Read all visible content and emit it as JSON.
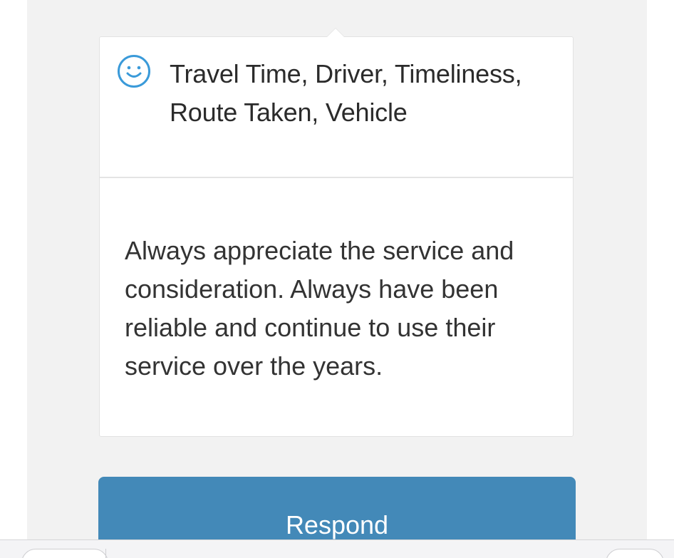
{
  "review_card": {
    "sentiment_icon": "smiley-icon",
    "categories": "Travel Time, Driver, Timeliness, Route Taken, Vehicle",
    "comment": "Always appreciate the service and consideration. Always have been reliable and continue to use their service over the years."
  },
  "actions": {
    "respond_label": "Respond"
  },
  "colors": {
    "accent": "#4389b8",
    "icon": "#3a9ad9",
    "panel_background": "#f2f2f2"
  }
}
